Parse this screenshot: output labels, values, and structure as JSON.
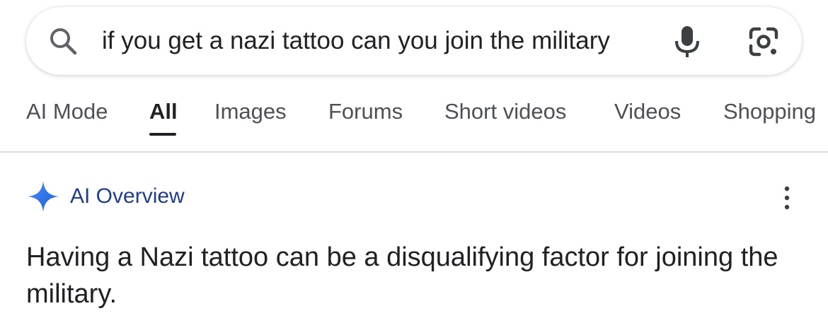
{
  "search": {
    "query": "if you get a nazi tattoo can you join the military",
    "icons": {
      "search": "search-icon",
      "voice": "mic-icon",
      "lens": "google-lens-icon"
    }
  },
  "tabs": {
    "ai_mode": "AI Mode",
    "all": "All",
    "images": "Images",
    "forums": "Forums",
    "short_videos": "Short videos",
    "videos": "Videos",
    "shopping": "Shopping",
    "active": "All"
  },
  "ai_overview": {
    "title": "AI Overview",
    "icon": "gemini-sparkle-icon",
    "menu_icon": "more-vert-icon",
    "answer": "Having a Nazi tattoo can be a disqualifying factor for joining the military."
  },
  "colors": {
    "text_primary": "#202124",
    "text_secondary": "#4d5156",
    "ai_title": "#1f3d8a",
    "sparkle": "#2b6fe8",
    "divider": "#dadce0"
  }
}
